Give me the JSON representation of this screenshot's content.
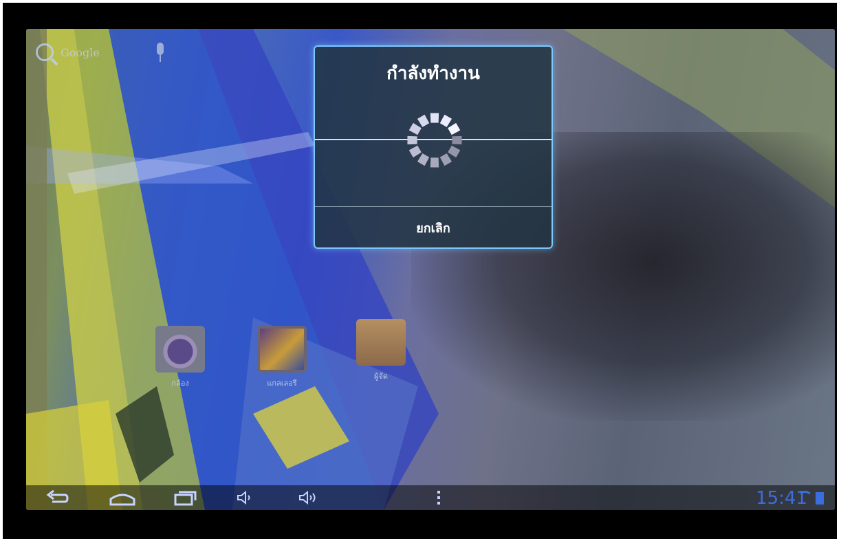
{
  "search_bar": {
    "label": "Google",
    "icon": "search-icon"
  },
  "voice_search": {
    "icon": "mic-icon"
  },
  "dialog": {
    "title": "กำลังทำงาน",
    "cancel_label": "ยกเลิก",
    "spinner_icon": "loading-spinner-icon",
    "border_color": "#7cc8ff"
  },
  "home_apps": [
    {
      "label": "กล้อง",
      "icon": "camera-icon"
    },
    {
      "label": "แกลเลอรี",
      "icon": "gallery-icon"
    },
    {
      "label": "ผู้จัด",
      "icon": "file-manager-icon"
    }
  ],
  "nav_bar": {
    "back_icon": "back-icon",
    "home_icon": "home-icon",
    "recents_icon": "recent-apps-icon",
    "volume_down_icon": "volume-down-icon",
    "volume_up_icon": "volume-up-icon",
    "menu_icon": "overflow-menu-icon"
  },
  "status": {
    "time": "15:41",
    "accent_color": "#3c6ddf"
  }
}
